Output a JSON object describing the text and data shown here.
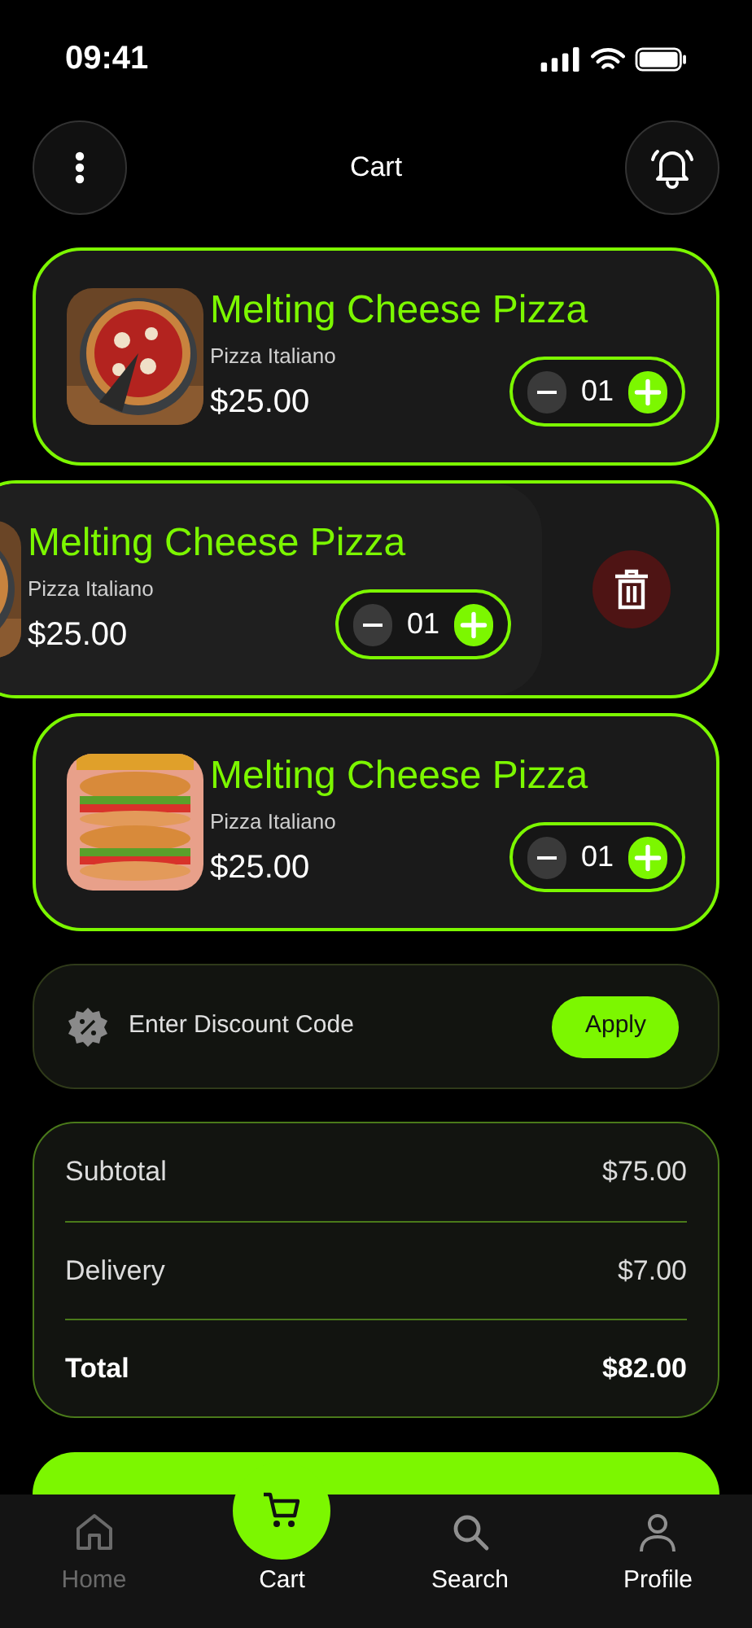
{
  "status_bar": {
    "time": "09:41"
  },
  "header": {
    "title": "Cart"
  },
  "cart_items": [
    {
      "name": "Melting Cheese Pizza",
      "subtitle": "Pizza Italiano",
      "price": "$25.00",
      "quantity": "01",
      "swiped": false
    },
    {
      "name": "Melting Cheese Pizza",
      "subtitle": "Pizza Italiano",
      "price": "$25.00",
      "quantity": "01",
      "swiped": true
    },
    {
      "name": "Melting Cheese Pizza",
      "subtitle": "Pizza Italiano",
      "price": "$25.00",
      "quantity": "01",
      "swiped": false
    }
  ],
  "discount": {
    "placeholder": "Enter Discount Code",
    "button": "Apply"
  },
  "summary": [
    {
      "label": "Subtotal",
      "value": "$75.00",
      "kind": "normal"
    },
    {
      "label": "Delivery",
      "value": "$7.00",
      "kind": "normal"
    },
    {
      "label": "Total",
      "value": "$82.00",
      "kind": "total"
    }
  ],
  "nav": [
    {
      "label": "Home",
      "selected": false,
      "disabled": true
    },
    {
      "label": "Cart",
      "selected": true,
      "disabled": false
    },
    {
      "label": "Search",
      "selected": false,
      "disabled": false
    },
    {
      "label": "Profile",
      "selected": false,
      "disabled": false
    }
  ]
}
